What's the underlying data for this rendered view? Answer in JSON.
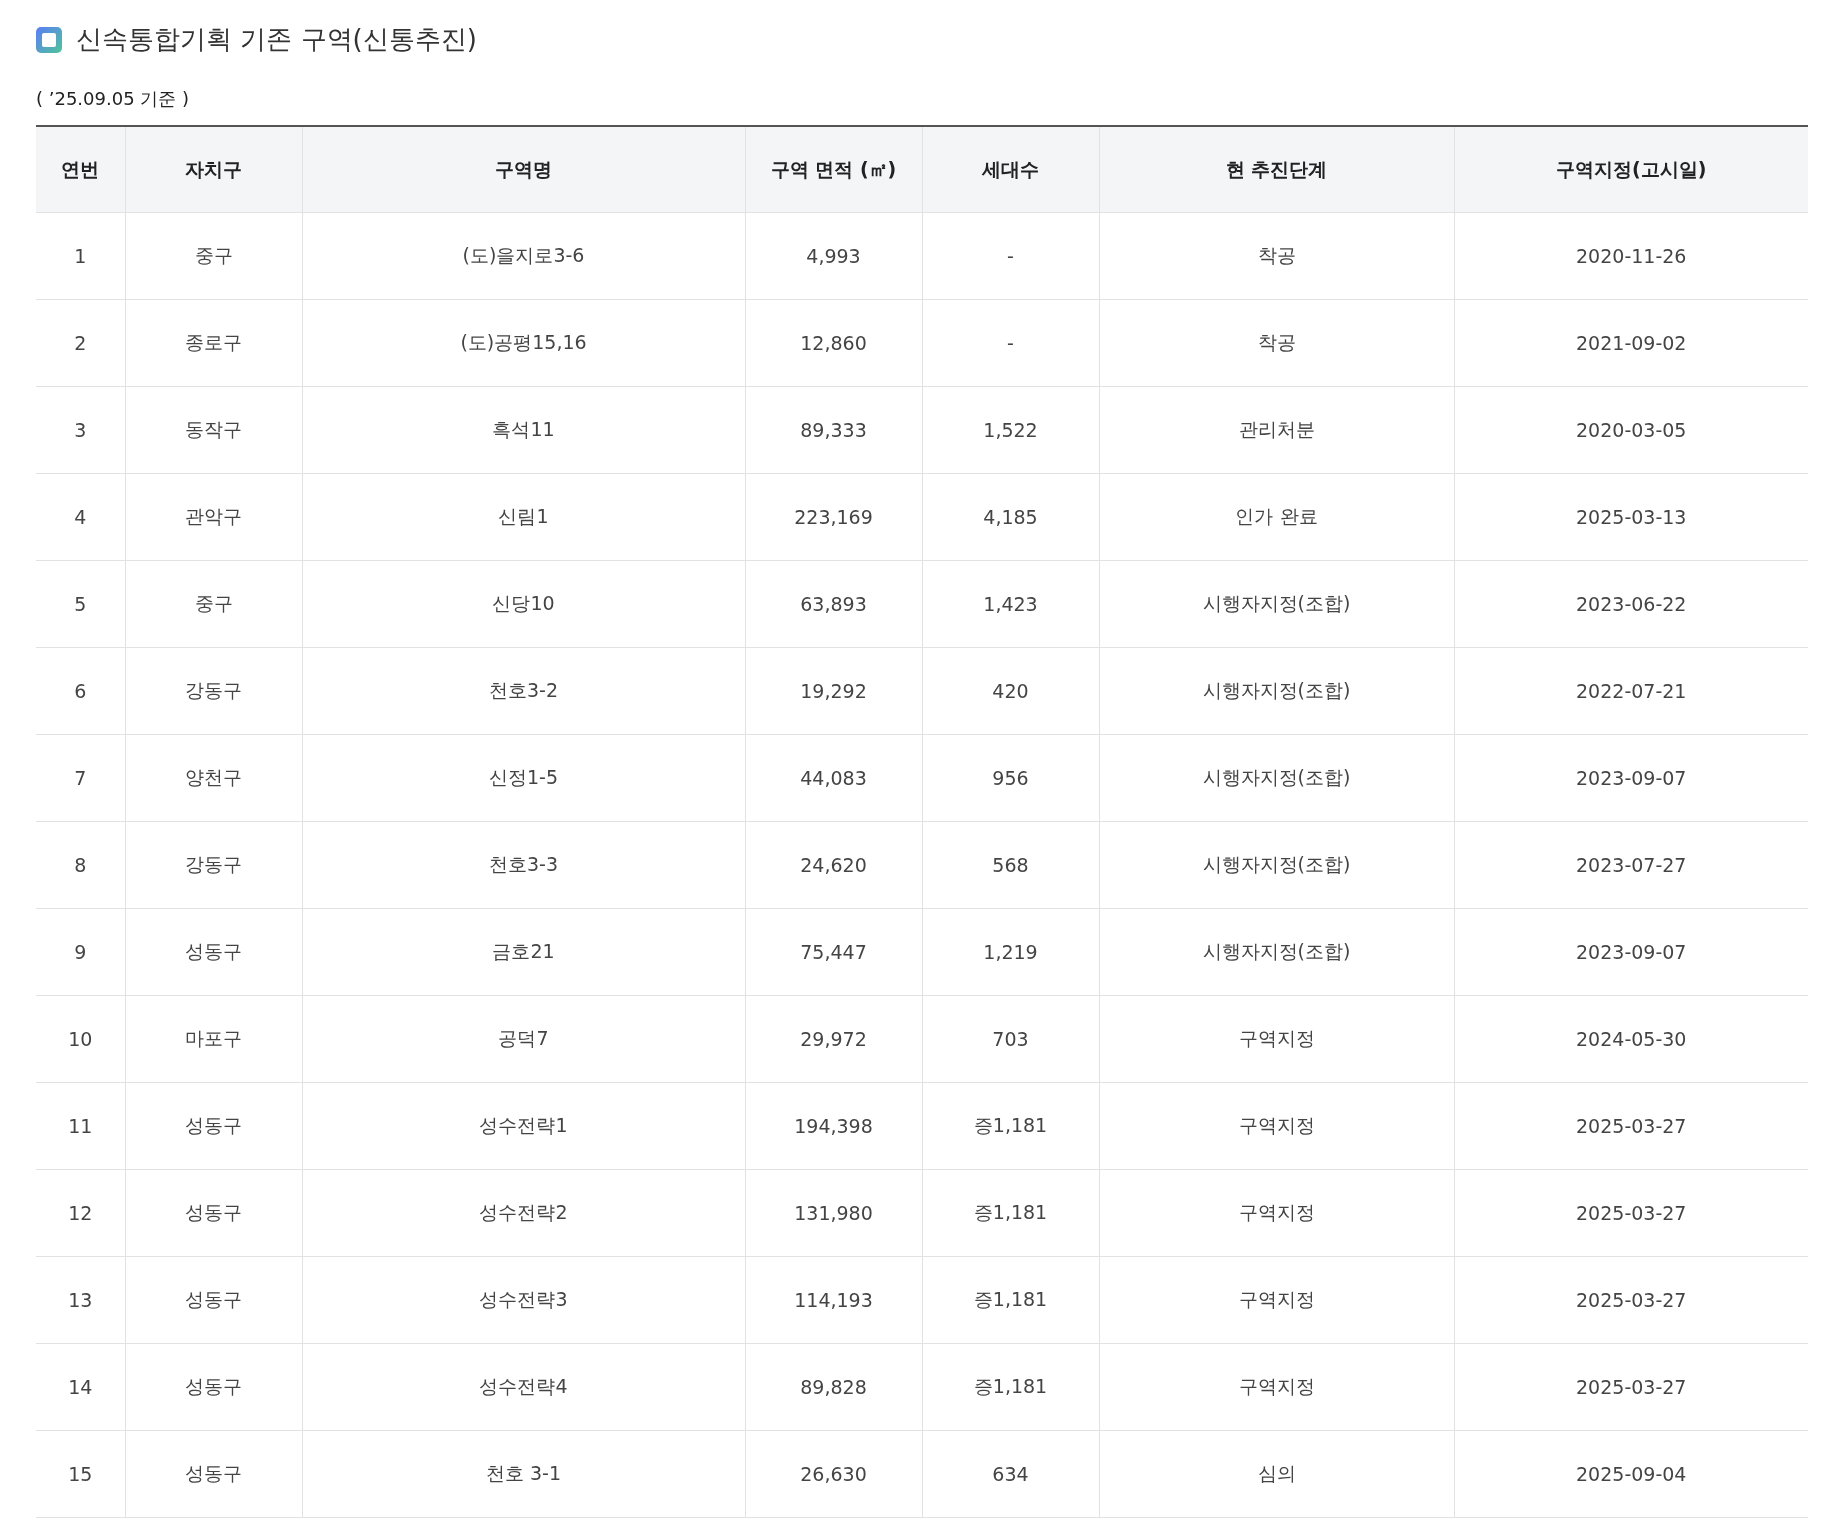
{
  "title": "신속통합기획 기존 구역(신통추진)",
  "as_of": "( ’25.09.05 기준 )",
  "table": {
    "columns": [
      "연번",
      "자치구",
      "구역명",
      "구역 면적 (㎡)",
      "세대수",
      "현 추진단계",
      "구역지정(고시일)"
    ],
    "rows": [
      [
        "1",
        "중구",
        "(도)을지로3-6",
        "4,993",
        "-",
        "착공",
        "2020-11-26"
      ],
      [
        "2",
        "종로구",
        "(도)공평15,16",
        "12,860",
        "-",
        "착공",
        "2021-09-02"
      ],
      [
        "3",
        "동작구",
        "흑석11",
        "89,333",
        "1,522",
        "관리처분",
        "2020-03-05"
      ],
      [
        "4",
        "관악구",
        "신림1",
        "223,169",
        "4,185",
        "인가 완료",
        "2025-03-13"
      ],
      [
        "5",
        "중구",
        "신당10",
        "63,893",
        "1,423",
        "시행자지정(조합)",
        "2023-06-22"
      ],
      [
        "6",
        "강동구",
        "천호3-2",
        "19,292",
        "420",
        "시행자지정(조합)",
        "2022-07-21"
      ],
      [
        "7",
        "양천구",
        "신정1-5",
        "44,083",
        "956",
        "시행자지정(조합)",
        "2023-09-07"
      ],
      [
        "8",
        "강동구",
        "천호3-3",
        "24,620",
        "568",
        "시행자지정(조합)",
        "2023-07-27"
      ],
      [
        "9",
        "성동구",
        "금호21",
        "75,447",
        "1,219",
        "시행자지정(조합)",
        "2023-09-07"
      ],
      [
        "10",
        "마포구",
        "공덕7",
        "29,972",
        "703",
        "구역지정",
        "2024-05-30"
      ],
      [
        "11",
        "성동구",
        "성수전략1",
        "194,398",
        "증1,181",
        "구역지정",
        "2025-03-27"
      ],
      [
        "12",
        "성동구",
        "성수전략2",
        "131,980",
        "증1,181",
        "구역지정",
        "2025-03-27"
      ],
      [
        "13",
        "성동구",
        "성수전략3",
        "114,193",
        "증1,181",
        "구역지정",
        "2025-03-27"
      ],
      [
        "14",
        "성동구",
        "성수전략4",
        "89,828",
        "증1,181",
        "구역지정",
        "2025-03-27"
      ],
      [
        "15",
        "성동구",
        "천호 3-1",
        "26,630",
        "634",
        "심의",
        "2025-09-04"
      ]
    ]
  }
}
